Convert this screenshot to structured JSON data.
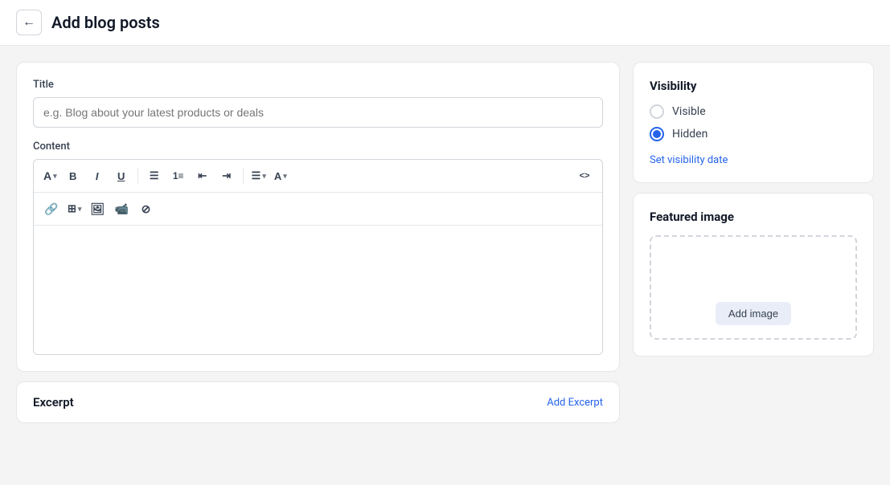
{
  "header": {
    "back_label": "←",
    "title": "Add blog posts"
  },
  "main": {
    "left": {
      "title_section": {
        "label": "Title",
        "placeholder": "e.g. Blog about your latest products or deals"
      },
      "content_section": {
        "label": "Content",
        "toolbar": {
          "row1": [
            {
              "id": "font",
              "label": "A",
              "has_arrow": true
            },
            {
              "id": "bold",
              "label": "B"
            },
            {
              "id": "italic",
              "label": "I"
            },
            {
              "id": "underline",
              "label": "U"
            },
            {
              "id": "divider1",
              "type": "divider"
            },
            {
              "id": "ul",
              "label": "≡"
            },
            {
              "id": "ol",
              "label": "≣"
            },
            {
              "id": "indent-left",
              "label": "⇤"
            },
            {
              "id": "indent-right",
              "label": "⇥"
            },
            {
              "id": "divider2",
              "type": "divider"
            },
            {
              "id": "align",
              "label": "≡",
              "has_arrow": true
            },
            {
              "id": "color",
              "label": "A",
              "has_arrow": true
            },
            {
              "id": "source",
              "label": "<>"
            }
          ],
          "row2": [
            {
              "id": "link",
              "label": "🔗"
            },
            {
              "id": "table",
              "label": "⊞",
              "has_arrow": true
            },
            {
              "id": "image",
              "label": "🖼"
            },
            {
              "id": "video",
              "label": "📹"
            },
            {
              "id": "block",
              "label": "⊘"
            }
          ]
        }
      },
      "excerpt": {
        "label": "Excerpt",
        "add_label": "Add Excerpt"
      }
    },
    "right": {
      "visibility": {
        "title": "Visibility",
        "options": [
          {
            "id": "visible",
            "label": "Visible",
            "checked": false
          },
          {
            "id": "hidden",
            "label": "Hidden",
            "checked": true
          }
        ],
        "set_date_label": "Set visibility date"
      },
      "featured_image": {
        "title": "Featured image",
        "add_label": "Add image"
      }
    }
  }
}
